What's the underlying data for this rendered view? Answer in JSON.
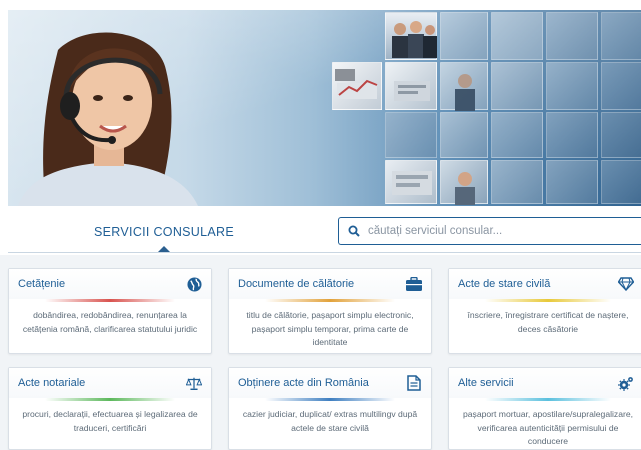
{
  "hero": {},
  "tabs": {
    "services_label": "SERVICII CONSULARE"
  },
  "search": {
    "placeholder": "căutați serviciul consular..."
  },
  "cards": [
    {
      "title": "Cetățenie",
      "icon": "globe-icon",
      "accent": "#d9534f",
      "desc": "dobândirea, redobândirea, renunțarea la cetățenia română, clarificarea statutului juridic"
    },
    {
      "title": "Documente de călătorie",
      "icon": "briefcase-icon",
      "accent": "#e2a23b",
      "desc": "titlu de călătorie, pașaport simplu electronic, pașaport simplu temporar, prima carte de identitate"
    },
    {
      "title": "Acte de stare civilă",
      "icon": "diamond-icon",
      "accent": "#e8c93a",
      "desc": "înscriere, înregistrare certificat de naștere, deces căsătorie"
    },
    {
      "title": "Acte notariale",
      "icon": "scales-icon",
      "accent": "#5cb85c",
      "desc": "procuri, declarații, efectuarea și legalizarea de traduceri, certificări"
    },
    {
      "title": "Obținere acte din România",
      "icon": "document-icon",
      "accent": "#3f7fc1",
      "desc": "cazier judiciar, duplicat/ extras multilingv după actele de stare civilă"
    },
    {
      "title": "Alte servicii",
      "icon": "gears-icon",
      "accent": "#5bc0de",
      "desc": "pașaport mortuar, apostilare/supralegalizare, verificarea autenticității permisului de conducere"
    }
  ]
}
